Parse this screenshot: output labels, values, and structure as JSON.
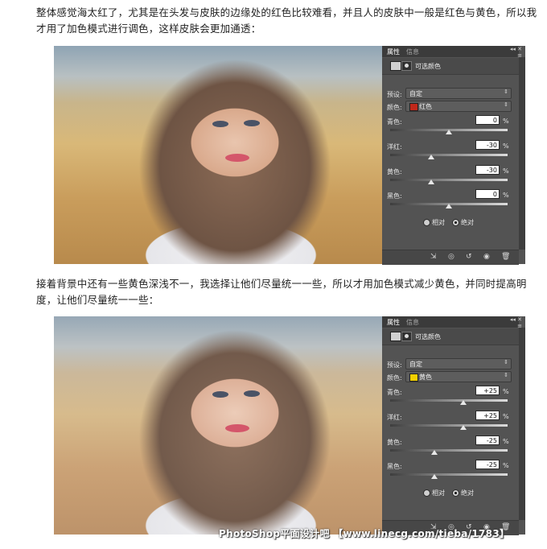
{
  "paragraph1": "整体感觉海太红了，尤其是在头发与皮肤的边缘处的红色比较难看，并且人的皮肤中一般是红色与黄色，所以我才用了加色模式进行调色，这样皮肤会更加通透：",
  "paragraph2": "接着背景中还有一些黄色深浅不一，我选择让他们尽量统一一些，所以才用加色模式减少黄色，并同时提高明度，让他们尽量统一一些：",
  "watermark": "PhotoShop平面设计吧 【www.linecg.com/tieba/1783】",
  "panels": [
    {
      "tab_active": "属性",
      "tab_inactive": "信息",
      "title": "可选颜色",
      "preset_label": "预设:",
      "preset_value": "自定",
      "color_label": "颜色:",
      "color_value": "红色",
      "color_swatch": "#c0281b",
      "sliders": [
        {
          "label": "青色:",
          "value": "0",
          "unit": "%",
          "level": 0
        },
        {
          "label": "洋红:",
          "value": "-30",
          "unit": "%",
          "level": -30
        },
        {
          "label": "黄色:",
          "value": "-30",
          "unit": "%",
          "level": -30
        },
        {
          "label": "黑色:",
          "value": "0",
          "unit": "%",
          "level": 0
        }
      ],
      "radio_relative": "相对",
      "radio_absolute": "绝对",
      "selected_mode": "absolute"
    },
    {
      "tab_active": "属性",
      "tab_inactive": "信息",
      "title": "可选颜色",
      "preset_label": "预设:",
      "preset_value": "自定",
      "color_label": "颜色:",
      "color_value": "黄色",
      "color_swatch": "#f2d000",
      "sliders": [
        {
          "label": "青色:",
          "value": "+25",
          "unit": "%",
          "level": 25
        },
        {
          "label": "洋红:",
          "value": "+25",
          "unit": "%",
          "level": 25
        },
        {
          "label": "黄色:",
          "value": "-25",
          "unit": "%",
          "level": -25
        },
        {
          "label": "黑色:",
          "value": "-25",
          "unit": "%",
          "level": -25
        }
      ],
      "radio_relative": "相对",
      "radio_absolute": "绝对",
      "selected_mode": "absolute"
    }
  ]
}
